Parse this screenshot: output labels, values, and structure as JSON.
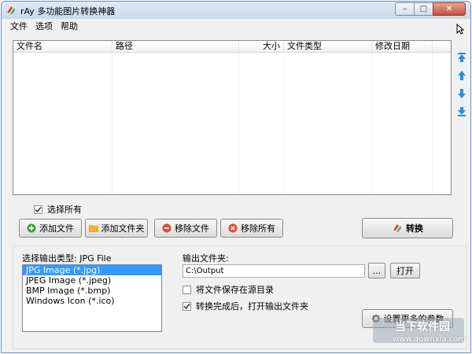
{
  "window": {
    "title": "rAy  多功能图片转换神器",
    "min_glyph": "–",
    "max_glyph": "□",
    "close_glyph": "✕"
  },
  "menu": [
    "文件",
    "选项",
    "帮助"
  ],
  "file_list": {
    "columns": [
      "文件名",
      "路径",
      "大小",
      "文件类型",
      "修改日期"
    ],
    "rows": []
  },
  "select_all": {
    "label": "选择所有",
    "checked": true
  },
  "buttons": {
    "add_file": "添加文件",
    "add_folder": "添加文件夹",
    "remove_file": "移除文件",
    "remove_all": "移除所有",
    "convert": "转换"
  },
  "output_type": {
    "label": "选择输出类型: JPG File",
    "options": [
      "JPG Image (*.jpg)",
      "JPEG Image (*.jpeg)",
      "BMP Image (*.bmp)",
      "Windows Icon (*.ico)"
    ],
    "selected_index": 0
  },
  "output_folder": {
    "label": "输出文件夹:",
    "value": "C:\\Output",
    "browse_label": "...",
    "open_label": "打开"
  },
  "options": {
    "save_in_source": {
      "label": "将文件保存在源目录",
      "checked": false
    },
    "open_after": {
      "label": "转换完成后，打开输出文件夹",
      "checked": true
    }
  },
  "more_settings_label": "设置更多的参数",
  "watermark": {
    "text": "当下软件园",
    "url": "www.downxia.com"
  },
  "colors": {
    "selection": "#3399ff",
    "titlebar": "#c9d9ec",
    "close_button": "#c7513b",
    "arrow_icons": "#2b8fd6"
  }
}
